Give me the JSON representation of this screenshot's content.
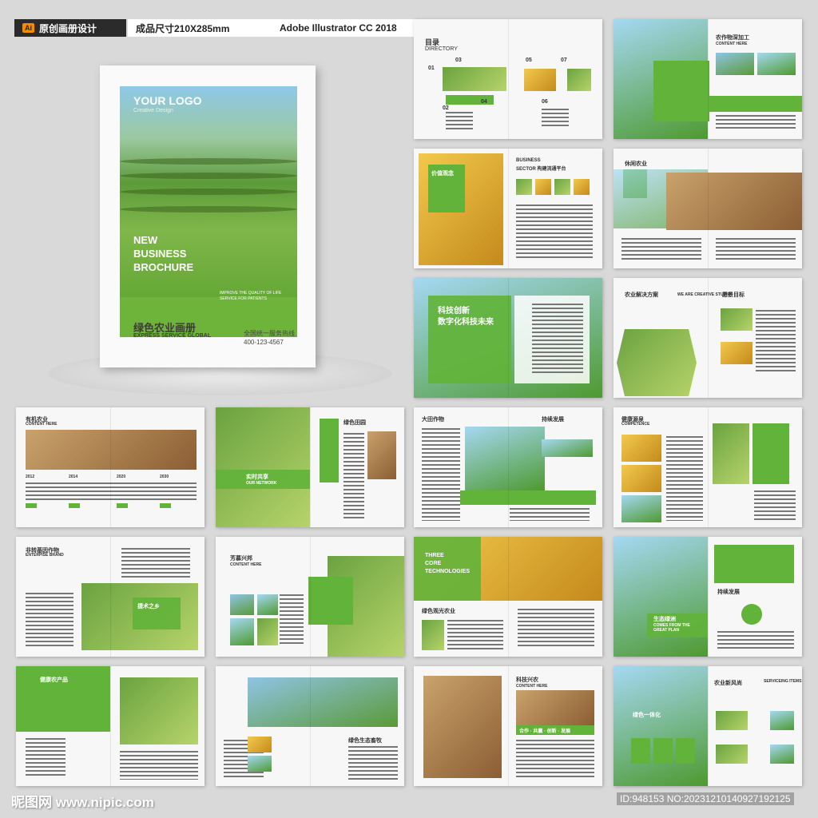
{
  "topbar": {
    "badge": "Ai",
    "item1": "原创画册设计",
    "item2": "成品尺寸210X285mm",
    "item3": "Adobe Illustrator CC 2018"
  },
  "cover": {
    "logo": "YOUR LOGO",
    "logo_sub": "Creative Design",
    "title_line1": "NEW",
    "title_line2": "BUSINESS",
    "title_line3": "BROCHURE",
    "note": "IMPROVE THE QUALITY OF LIFE SERVICE FOR PATIENTS",
    "cn_title": "绿色农业画册",
    "en_title": "EXPRESS SERVICE GLOBAL",
    "hotline": "全国统一服务热线",
    "tel": "400-123-4567"
  },
  "spreads": {
    "s1": {
      "title": "目录",
      "sub": "DIRECTORY",
      "n1": "01",
      "n2": "02",
      "n3": "03",
      "n4": "04",
      "n5": "05",
      "n6": "06",
      "n7": "07"
    },
    "s2": {
      "title": "农作物深加工",
      "sub": "CONTENT HERE"
    },
    "s3": {
      "title": "价值观念",
      "h1": "BUSINESS",
      "h2": "SECTOR 构建流通平台"
    },
    "s4": {
      "title": "休闲农业"
    },
    "s5": {
      "title1": "科技创新",
      "title2": "数字化科技未来"
    },
    "s6": {
      "title": "农业解决方案",
      "sub": "WE ARE CREATIVE STUDIO",
      "t2": "愿景目标"
    },
    "s7": {
      "title": "有机农业",
      "sub": "CONTENT HERE",
      "y1": "2012",
      "y2": "2014",
      "y3": "2020",
      "y4": "2030"
    },
    "s8": {
      "title": "绿色田园",
      "band": "实时共享",
      "band_sub": "OUR NETWORK"
    },
    "s9": {
      "title": "大田作物",
      "t2": "持续发展"
    },
    "s10": {
      "title": "健康源泉",
      "sub": "COMPETENCE"
    },
    "s11": {
      "title": "非转基因作物",
      "sub": "ENTERPISE BRAND",
      "quote": "捷术之乡"
    },
    "s12": {
      "title": "芳慕兴邦",
      "sub": "CONTENT HERE"
    },
    "s13": {
      "title1": "THREE",
      "title2": "CORE",
      "title3": "TECHNOLOGIES",
      "cap": "绿色观光农业"
    },
    "s14": {
      "title": "持续发展",
      "green": "生态绿洲",
      "green_sub": "COMES FROM THE GREAT PLAN"
    },
    "s15": {
      "title": "健康农产品"
    },
    "s16": {
      "title": "绿色生态畜牧"
    },
    "s17": {
      "title": "科技兴农",
      "sub": "CONTENT HERE",
      "banner": "合作 · 共赢 · 创新 · 发展"
    },
    "s18": {
      "title": "绿色一体化",
      "t2": "农业新风尚",
      "t3": "SERVICEING ITEMS"
    }
  },
  "footer": {
    "left": "昵图网 www.nipic.com",
    "right": "ID:948153 NO:20231210140927192125"
  },
  "colors": {
    "accent": "#62b33a",
    "bg": "#d9d9d9"
  }
}
